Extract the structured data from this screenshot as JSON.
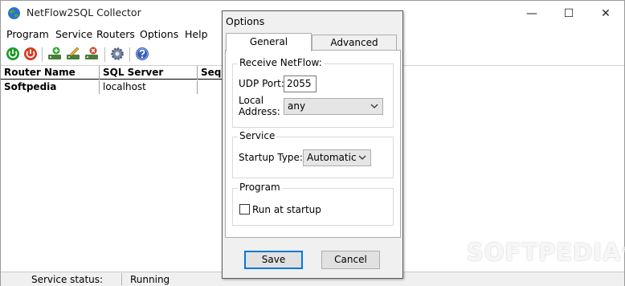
{
  "window": {
    "title": "NetFlow2SQL Collector",
    "controls": {
      "minimize": "—",
      "maximize": "☐",
      "close": "✕"
    }
  },
  "menu": {
    "items": [
      "Program",
      "Service",
      "Routers",
      "Options",
      "Help"
    ]
  },
  "toolbar": {
    "icons": [
      "start-service-icon",
      "stop-service-icon",
      "add-router-icon",
      "edit-router-icon",
      "delete-router-icon",
      "settings-icon",
      "help-icon"
    ]
  },
  "table": {
    "columns": [
      "Router Name",
      "SQL Server",
      "Seque"
    ],
    "rows": [
      {
        "router": "Softpedia",
        "server": "localhost",
        "seq": ""
      }
    ]
  },
  "status": {
    "label": "Service status:",
    "value": "Running"
  },
  "watermark": {
    "text": "SOFTPEDIA",
    "mark": "®"
  },
  "dialog": {
    "title": "Options",
    "tabs": [
      "General",
      "Advanced"
    ],
    "receive": {
      "title": "Receive NetFlow:",
      "udp_label": "UDP Port:",
      "udp_value": "2055",
      "local_label_1": "Local",
      "local_label_2": "Address:",
      "address_value": "any"
    },
    "service": {
      "title": "Service",
      "startup_label": "Startup Type:",
      "startup_value": "Automatic"
    },
    "program": {
      "title": "Program",
      "run_label": "Run at startup",
      "run_checked": false
    },
    "buttons": {
      "save": "Save",
      "cancel": "Cancel"
    }
  },
  "colors": {
    "accent": "#0078d7",
    "dialog_bg": "#f0f0f0",
    "power_green": "#1e9a2a",
    "power_red": "#d63a1f",
    "help_blue": "#3a5fb8"
  }
}
